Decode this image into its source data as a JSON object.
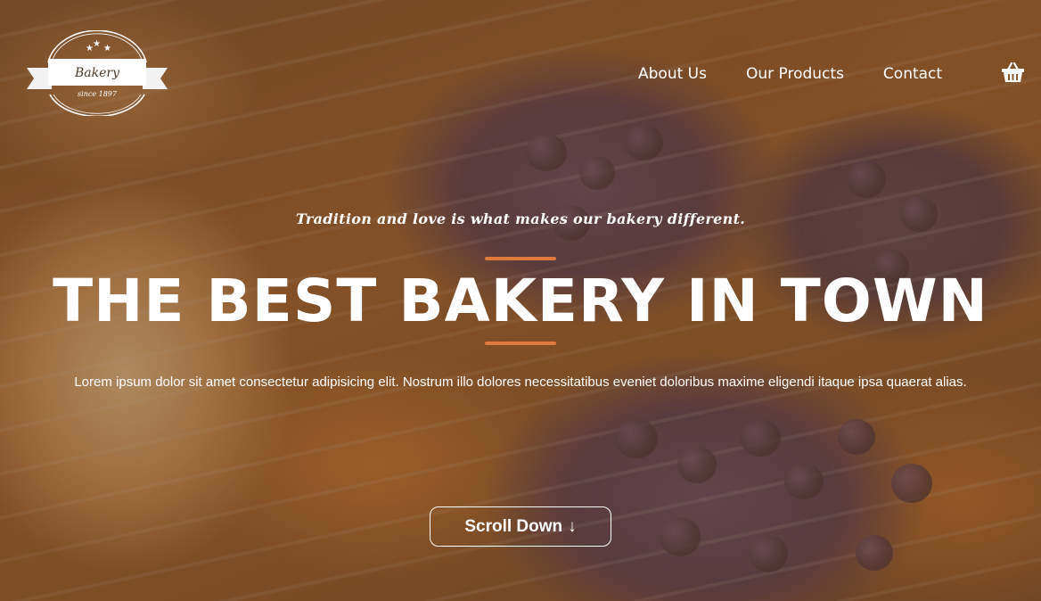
{
  "header": {
    "logo": {
      "name": "Bakery",
      "since": "since 1897"
    },
    "nav": [
      {
        "label": "About Us"
      },
      {
        "label": "Our Products"
      },
      {
        "label": "Contact"
      }
    ],
    "cart_icon": "basket-icon"
  },
  "hero": {
    "tagline": "Tradition and love is what makes our bakery different.",
    "title": "THE BEST BAKERY IN TOWN",
    "description": "Lorem ipsum dolor sit amet consectetur adipisicing elit. Nostrum illo dolores necessitatibus eveniet doloribus maxime eligendi itaque ipsa quaerat alias.",
    "button": {
      "label": "Scroll Down",
      "icon": "arrow-down-icon",
      "arrow": "↓"
    }
  },
  "colors": {
    "accent": "#e07a3c",
    "overlay": "#693c14",
    "text": "#ffffff"
  }
}
